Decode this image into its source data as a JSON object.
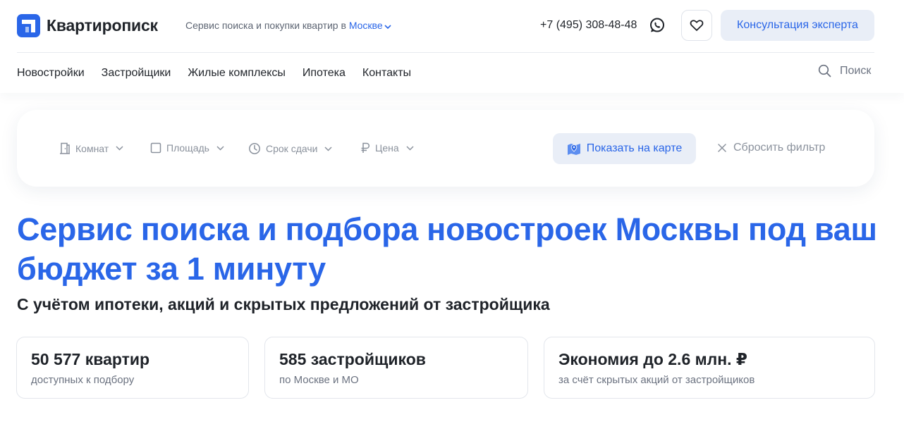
{
  "header": {
    "logo_text": "Квартирописк",
    "tagline": "Сервис поиска и покупки квартир в",
    "city": "Москве",
    "phone": "+7 (495) 308-48-48",
    "consult_label": "Консультация эксперта"
  },
  "nav": {
    "items": [
      "Новостройки",
      "Застройщики",
      "Жилые комплексы",
      "Ипотека",
      "Контакты"
    ],
    "search_label": "Поиск"
  },
  "filters": {
    "items": [
      {
        "label": "Комнат",
        "icon": "door-icon"
      },
      {
        "label": "Площадь",
        "icon": "square-icon"
      },
      {
        "label": "Срок сдачи",
        "icon": "clock-icon"
      },
      {
        "label": "Цена",
        "icon": "ruble-icon"
      }
    ],
    "map_label": "Показать на карте",
    "reset_label": "Сбросить фильтр"
  },
  "hero": {
    "title": "Сервис поиска и подбора новостроек Москвы под ваш бюджет за 1 минуту",
    "subtitle": "С учётом ипотеки, акций и скрытых предложений от застройщика"
  },
  "stats": [
    {
      "value": "50 577 квартир",
      "caption": "доступных к подбору"
    },
    {
      "value": "585 застройщиков",
      "caption": "по Москве и МО"
    },
    {
      "value": "Экономия до 2.6 млн. ₽",
      "caption": "за счёт скрытых акций от застройщиков"
    }
  ],
  "colors": {
    "accent": "#2a66e8",
    "accent_light": "#e9eef7",
    "text": "#1f2329",
    "muted": "#8a919c"
  }
}
